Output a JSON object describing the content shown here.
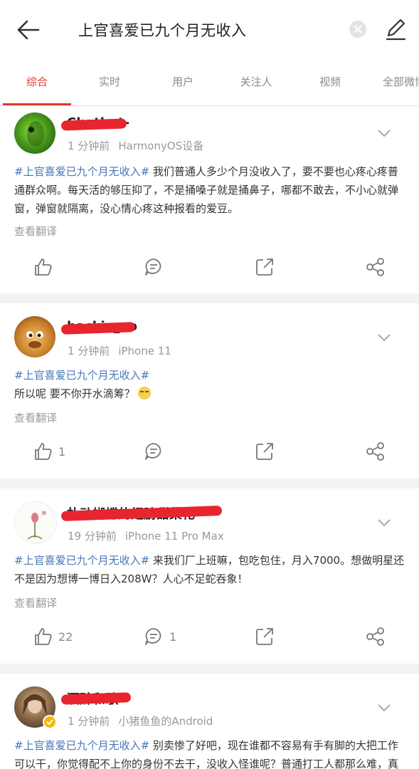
{
  "search": {
    "query": "上官喜爱已九个月无收入"
  },
  "tabs": [
    {
      "label": "综合",
      "active": true
    },
    {
      "label": "实时"
    },
    {
      "label": "用户"
    },
    {
      "label": "关注人"
    },
    {
      "label": "视频"
    },
    {
      "label": "全部微博"
    }
  ],
  "colors": {
    "accent": "#e8362c",
    "hashtag": "#4a76b8",
    "redaction": "#e8252f"
  },
  "posts": [
    {
      "username": "Chatbot-",
      "time": "1 分钟前",
      "source": "HarmonyOS设备",
      "hashtag": "#上官喜爱已九个月无收入#",
      "text": " 我们普通人多少个月没收入了，要不要也心疼心疼普通群众啊。每天活的够压抑了，不是捅嗓子就是捅鼻子，哪都不敢去，不小心就弹窗，弹窗就隔离，没心情心疼这种报看的爱豆。",
      "translate": "查看翻译",
      "likes": "",
      "comments": ""
    },
    {
      "username": "backix_ao",
      "time": "1 分钟前",
      "source": "iPhone 11",
      "hashtag": "#上官喜爱已九个月无收入#",
      "text": "所以呢 要不你开水滴筹？",
      "translate": "查看翻译",
      "likes": "1",
      "comments": ""
    },
    {
      "username": "扑动蝴蝶的翅膀甜菜花",
      "time": "19 分钟前",
      "source": "iPhone 11 Pro Max",
      "hashtag": "#上官喜爱已九个月无收入#",
      "text": " 来我们厂上班嘛，包吃包住，月入7000。想做明星还不是因为想博一博日入208W？人心不足蛇吞象！",
      "translate": "查看翻译",
      "likes": "22",
      "comments": "1"
    },
    {
      "username": "酒醉和歌",
      "time": "1 分钟前",
      "source": "小猪鱼鱼的Android",
      "hashtag": "#上官喜爱已九个月无收入#",
      "text": " 别卖惨了好吧，现在谁都不容易有手有脚的大把工作可以干，你觉得配不上你的身份不去干，没收入怪谁呢？普通打工人都那么难，真"
    }
  ]
}
